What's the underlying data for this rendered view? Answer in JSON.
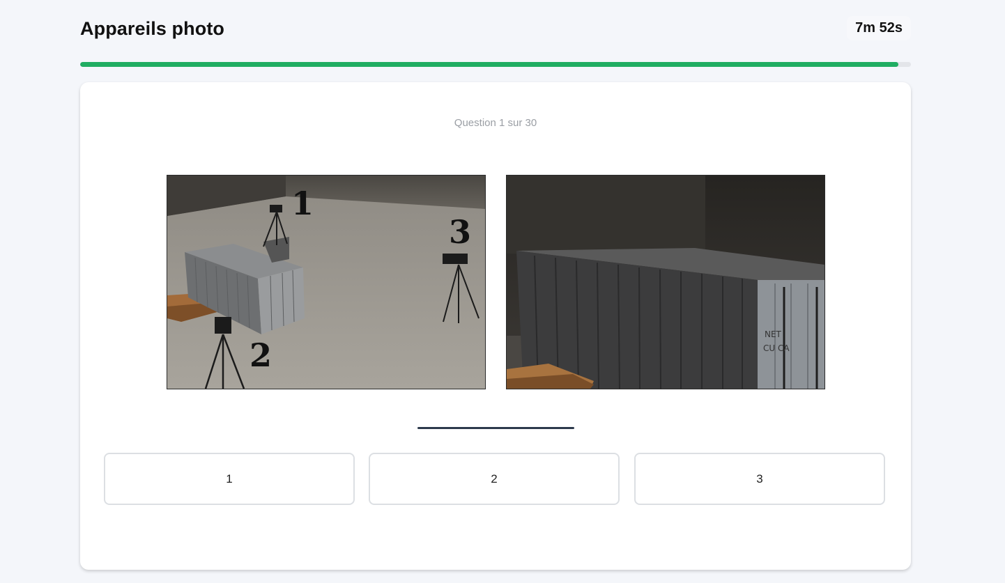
{
  "header": {
    "title": "Appareils photo",
    "timer": "7m 52s"
  },
  "progress": {
    "fraction": 0.985,
    "color": "#20ad62"
  },
  "question": {
    "counter": "Question 1 sur 30",
    "images": [
      {
        "name": "overview-scene",
        "labels": [
          "1",
          "2",
          "3"
        ]
      },
      {
        "name": "camera-view",
        "labels": [
          "NET",
          "CU CA"
        ]
      }
    ]
  },
  "answers": [
    {
      "label": "1"
    },
    {
      "label": "2"
    },
    {
      "label": "3"
    }
  ]
}
